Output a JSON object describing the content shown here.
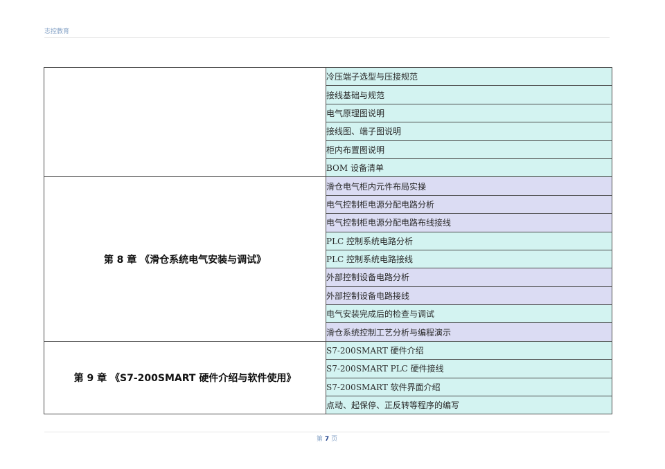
{
  "header": {
    "org": "志控教育"
  },
  "colors": {
    "teal_row": "#d3f3f1",
    "lavender_row": "#dbdcf3",
    "header_text": "#8aa6c8"
  },
  "sections": [
    {
      "chapter": "",
      "items": [
        "冷压端子选型与压接规范",
        "接线基础与规范",
        "电气原理图说明",
        "接线图、端子图说明",
        "柜内布置图说明",
        "BOM 设备清单"
      ]
    },
    {
      "chapter": "第 8 章 《滑仓系统电气安装与调试》",
      "items": [
        "滑仓电气柜内元件布局实操",
        "电气控制柜电源分配电路分析",
        "电气控制柜电源分配电路布线接线",
        "PLC 控制系统电路分析",
        "PLC 控制系统电路接线",
        "外部控制设备电路分析",
        "外部控制设备电路接线",
        "电气安装完成后的检查与调试",
        "滑仓系统控制工艺分析与编程演示"
      ]
    },
    {
      "chapter": "第 9 章 《S7-200SMART 硬件介绍与软件使用》",
      "items": [
        "S7-200SMART 硬件介绍",
        "S7-200SMART PLC 硬件接线",
        "S7-200SMART 软件界面介绍",
        "点动、起保停、正反转等程序的编写"
      ]
    }
  ],
  "footer": {
    "prefix": "第",
    "page": "7",
    "suffix": "页"
  }
}
